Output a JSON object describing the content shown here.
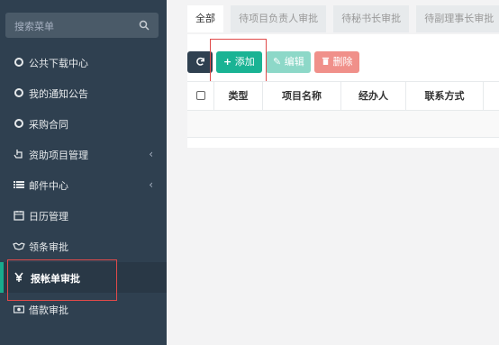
{
  "sidebar": {
    "search_placeholder": "搜索菜单",
    "items": [
      {
        "label": "公共下载中心",
        "icon": "circle-outline-icon",
        "has_submenu": false
      },
      {
        "label": "我的通知公告",
        "icon": "circle-outline-icon",
        "has_submenu": false
      },
      {
        "label": "采购合同",
        "icon": "circle-outline-icon",
        "has_submenu": false
      },
      {
        "label": "资助项目管理",
        "icon": "hand-pointer-icon",
        "has_submenu": true
      },
      {
        "label": "邮件中心",
        "icon": "list-icon",
        "has_submenu": true
      },
      {
        "label": "日历管理",
        "icon": "calendar-icon",
        "has_submenu": false
      },
      {
        "label": "领条审批",
        "icon": "handshake-icon",
        "has_submenu": false
      },
      {
        "label": "报帐单审批",
        "icon": "yen-icon",
        "has_submenu": false,
        "active": true
      },
      {
        "label": "借款审批",
        "icon": "money-icon",
        "has_submenu": false
      }
    ],
    "submenu_chevron": "‹"
  },
  "tabs": [
    {
      "label": "全部",
      "active": true
    },
    {
      "label": "待项目负责人审批",
      "active": false
    },
    {
      "label": "待秘书长审批",
      "active": false
    },
    {
      "label": "待副理事长审批",
      "active": false
    }
  ],
  "toolbar": {
    "add_label": "添加",
    "edit_label": "编辑",
    "delete_label": "删除"
  },
  "table": {
    "columns": [
      "类型",
      "项目名称",
      "经办人",
      "联系方式"
    ]
  },
  "colors": {
    "sidebar_bg": "#2f4050",
    "primary": "#1ab394",
    "danger": "#ed5565",
    "highlight": "#e04a4a"
  }
}
